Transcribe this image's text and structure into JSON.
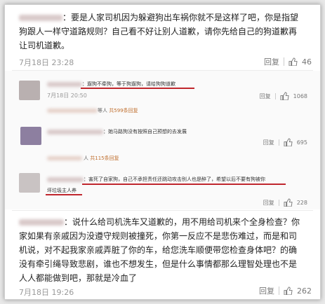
{
  "comments": [
    {
      "text_lines": [
        "：要是人家司机因为躲避狗出车祸你就不是这样了吧，你是指望",
        "狗跟人一样守道路规则？自己看不好让别人道歉，请你先给自己的狗道歉再",
        "让司机道歉。"
      ],
      "time": "7月18日 23:28",
      "reply": "回复",
      "likes": "46"
    },
    {
      "text": "：遛狗不牵狗，等于狗遛狗，请给狗狗道歉",
      "time": "7月18日 20:50",
      "reply": "回复",
      "likes": "1068",
      "sub_reply_prefix": "等人",
      "sub_reply_count": "共599条回复"
    },
    {
      "text": "：她马路狗没有按照自己预想的去发展",
      "reply": "回复",
      "likes": "695",
      "sub_reply_prefix": "人",
      "sub_reply_count": "共115条回复"
    },
    {
      "text_lines": [
        "：害死了自家狗，自己不承担责任还跳动攻击别人也是醉了，希望以后不要有狗被你",
        "坪垃圾主人养"
      ],
      "reply": "回复",
      "likes": "228"
    },
    {
      "text_lines": [
        "：说什么给司机洗车又道歉的，用不用给司机来个全身检查？你",
        "家如果有亲戚因为没遵守规则被撞死，你第一反应不是悲伤难过，而是和司",
        "机说，对不起我家亲戚弄脏了你的车，给您洗车顺便带您检查身体吧？的确",
        "没有牵引绳导致悲剧，谁也不想发生，但是什么事情都那么理智处理也不是",
        "人人都能做到吧，那就是冷血了"
      ],
      "time": "7月18日 19:26",
      "reply": "回复",
      "likes": "262"
    }
  ]
}
